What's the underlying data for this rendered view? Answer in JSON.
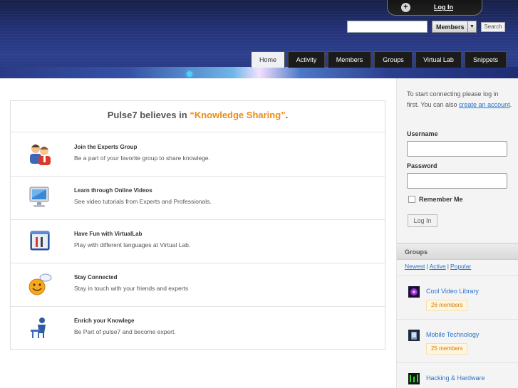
{
  "header": {
    "login_label": "Log In",
    "search_placeholder": "",
    "search_scope": "Members",
    "search_button": "Search"
  },
  "nav": {
    "tabs": [
      {
        "label": "Home",
        "active": true
      },
      {
        "label": "Activity",
        "active": false
      },
      {
        "label": "Members",
        "active": false
      },
      {
        "label": "Groups",
        "active": false
      },
      {
        "label": "Virtual Lab",
        "active": false
      },
      {
        "label": "Snippets",
        "active": false
      }
    ]
  },
  "main": {
    "title_prefix": "Pulse7 believes in ",
    "title_highlight": "“Knowledge Sharing”",
    "title_suffix": ".",
    "features": [
      {
        "title": "Join the Experts Group",
        "desc": "Be a part of your favorite group to share knowlege.",
        "icon": "experts-group-icon"
      },
      {
        "title": "Learn through Online Videos",
        "desc": "See video tutorials from Experts and Professionals.",
        "icon": "monitor-icon"
      },
      {
        "title": "Have Fun with VirtualLab",
        "desc": "Play with different languages at Virtual Lab.",
        "icon": "virtual-lab-icon"
      },
      {
        "title": "Stay Connected",
        "desc": "Stay in touch with your friends and experts",
        "icon": "smiley-chat-icon"
      },
      {
        "title": "Enrich your Knowlege",
        "desc": "Be Part of pulse7 and become expert.",
        "icon": "learner-icon"
      }
    ]
  },
  "sidebar": {
    "intro_text": "To start connecting please log in first. You can also ",
    "intro_link": "create an account",
    "intro_end": ".",
    "username_label": "Username",
    "password_label": "Password",
    "remember_label": "Remember Me",
    "login_button": "Log In",
    "groups_title": "Groups",
    "filters": [
      "Newest",
      "Active",
      "Popular"
    ],
    "groups": [
      {
        "name": "Cool Video Library",
        "members": "26 members"
      },
      {
        "name": "Mobile Technology",
        "members": "25 members"
      },
      {
        "name": "Hacking & Hardware",
        "members": ""
      }
    ]
  },
  "colors": {
    "accent": "#ef8a14",
    "link": "#2a74c8",
    "nav_bg": "#1b1b1b",
    "header_bg": "#2d3f8e"
  }
}
